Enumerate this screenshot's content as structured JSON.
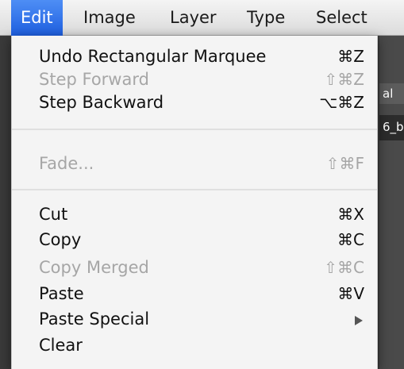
{
  "menubar": {
    "items": [
      {
        "label": "Edit",
        "active": true
      },
      {
        "label": "Image"
      },
      {
        "label": "Layer"
      },
      {
        "label": "Type"
      },
      {
        "label": "Select"
      }
    ]
  },
  "background_app": {
    "fragments": [
      "al",
      "6_b"
    ]
  },
  "edit_menu": {
    "items": [
      {
        "label": "Undo Rectangular Marquee",
        "shortcut": "⌘Z",
        "enabled": true
      },
      {
        "label": "Step Forward",
        "shortcut": "⇧⌘Z",
        "enabled": false
      },
      {
        "label": "Step Backward",
        "shortcut": "⌥⌘Z",
        "enabled": true
      },
      {
        "label": "Fade...",
        "shortcut": "⇧⌘F",
        "enabled": false
      },
      {
        "label": "Cut",
        "shortcut": "⌘X",
        "enabled": true
      },
      {
        "label": "Copy",
        "shortcut": "⌘C",
        "enabled": true
      },
      {
        "label": "Copy Merged",
        "shortcut": "⇧⌘C",
        "enabled": false
      },
      {
        "label": "Paste",
        "shortcut": "⌘V",
        "enabled": true
      },
      {
        "label": "Paste Special",
        "submenu": true,
        "enabled": true
      },
      {
        "label": "Clear",
        "enabled": true
      }
    ],
    "submenu_icon": "chevron-right-icon"
  },
  "colors": {
    "menu_highlight": "#2f6fe8",
    "disabled_text": "#a6a6a6",
    "enabled_text": "#111111"
  }
}
